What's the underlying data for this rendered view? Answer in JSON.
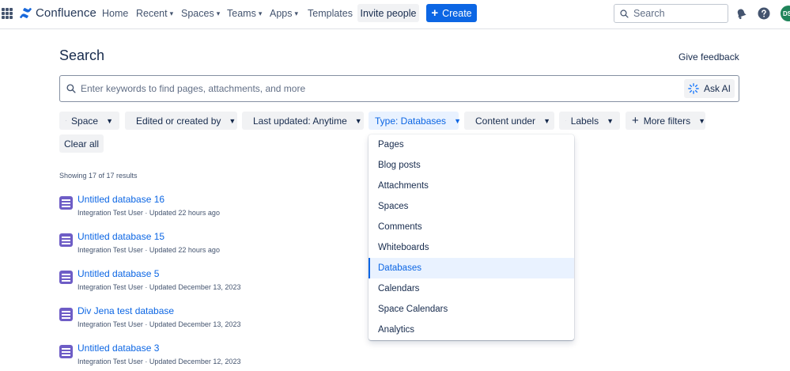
{
  "nav": {
    "brand": "Confluence",
    "items": [
      {
        "label": "Home"
      },
      {
        "label": "Recent"
      },
      {
        "label": "Spaces"
      },
      {
        "label": "Teams"
      },
      {
        "label": "Apps"
      },
      {
        "label": "Templates"
      }
    ],
    "invite_label": "Invite people",
    "create_label": "Create",
    "search_placeholder": "Search",
    "avatar_initials": "DS",
    "icons": [
      "app-switcher-icon",
      "confluence-logo-icon",
      "search-icon",
      "notifications-icon",
      "help-icon"
    ]
  },
  "page": {
    "title": "Search",
    "give_feedback": "Give feedback",
    "search_placeholder": "Enter keywords to find pages, attachments, and more",
    "ask_ai": "Ask AI"
  },
  "filters": {
    "space": "Space",
    "edited_by": "Edited or created by",
    "last_updated": "Last updated: Anytime",
    "type": "Type: Databases",
    "content_under": "Content under",
    "labels": "Labels",
    "more_filters": "More filters",
    "clear_all": "Clear all"
  },
  "results": {
    "count_text": "Showing 17 of 17 results",
    "items": [
      {
        "title": "Untitled database 16",
        "meta": "Integration Test User · Updated 22 hours ago"
      },
      {
        "title": "Untitled database 15",
        "meta": "Integration Test User · Updated 22 hours ago"
      },
      {
        "title": "Untitled database 5",
        "meta": "Integration Test User · Updated December 13, 2023"
      },
      {
        "title": "Div Jena test database",
        "meta": "Integration Test User · Updated December 13, 2023"
      },
      {
        "title": "Untitled database 3",
        "meta": "Integration Test User · Updated December 12, 2023"
      }
    ]
  },
  "type_dropdown": {
    "selected": "Databases",
    "options": [
      {
        "label": "Pages"
      },
      {
        "label": "Blog posts"
      },
      {
        "label": "Attachments"
      },
      {
        "label": "Spaces"
      },
      {
        "label": "Comments"
      },
      {
        "label": "Whiteboards"
      },
      {
        "label": "Databases"
      },
      {
        "label": "Calendars"
      },
      {
        "label": "Space Calendars"
      },
      {
        "label": "Analytics"
      }
    ]
  },
  "colors": {
    "brand_blue": "#0c66e4",
    "database_purple": "#6e5dc6",
    "avatar_green": "#1f845a"
  }
}
